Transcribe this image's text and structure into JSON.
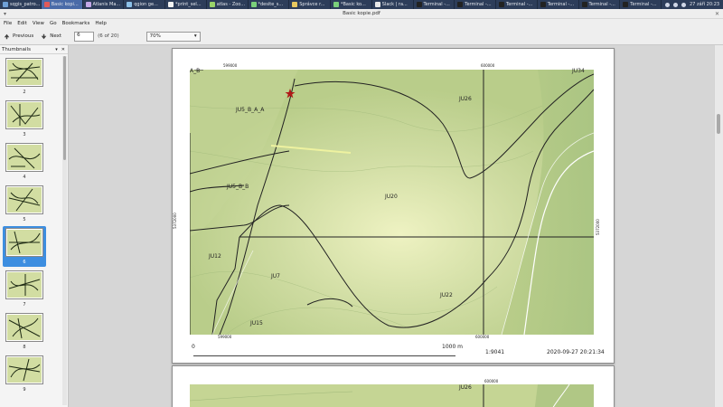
{
  "taskbar": {
    "apps": [
      {
        "label": "sqgis_patro..."
      },
      {
        "label": "Basic kopi..."
      },
      {
        "label": "Atlanis Ma..."
      },
      {
        "label": "qgion ge..."
      },
      {
        "label": "*print_sel..."
      },
      {
        "label": "atlas - Zoo..."
      },
      {
        "label": "*desite_s..."
      },
      {
        "label": "Správce r..."
      },
      {
        "label": "*Basic ko..."
      },
      {
        "label": "Slack | ra..."
      },
      {
        "label": "Terminal -..."
      },
      {
        "label": "Terminal -..."
      },
      {
        "label": "Terminal -..."
      },
      {
        "label": "Terminal -..."
      },
      {
        "label": "Terminal -..."
      },
      {
        "label": "Terminal -..."
      }
    ],
    "clock": "27 září 20:23"
  },
  "window": {
    "title": "Basic kopie.pdf"
  },
  "menu": [
    "File",
    "Edit",
    "View",
    "Go",
    "Bookmarks",
    "Help"
  ],
  "toolbar": {
    "previous_label": "Previous",
    "next_label": "Next",
    "page_value": "6",
    "page_of": "(6 of 20)",
    "zoom_value": "70%"
  },
  "sidebar": {
    "title": "Thumbnails",
    "thumbs": [
      {
        "label": "2"
      },
      {
        "label": "3"
      },
      {
        "label": "4"
      },
      {
        "label": "5"
      },
      {
        "label": "6"
      },
      {
        "label": "7"
      },
      {
        "label": "8"
      },
      {
        "label": "9"
      }
    ],
    "selected_index": 4
  },
  "map": {
    "zones": [
      {
        "label": "A_B"
      },
      {
        "label": "JU34"
      },
      {
        "label": "JU26"
      },
      {
        "label": "JU5_B_A_A"
      },
      {
        "label": "JU5_B_B"
      },
      {
        "label": "JU20"
      },
      {
        "label": "JU12"
      },
      {
        "label": "JU7"
      },
      {
        "label": "JU22"
      },
      {
        "label": "JU15"
      }
    ],
    "coords": {
      "top_a": "599000",
      "top_b": "600000",
      "bottom_a": "599000",
      "bottom_b": "600000",
      "left_side": "5372000",
      "right_side": "5372000"
    },
    "scale_start": "0",
    "scale_end": "1000 m",
    "scale_ratio": "1:9041",
    "timestamp": "2020-09-27 20:21:34",
    "next_page_label": "JU26",
    "next_page_coord": "600000"
  },
  "colors": {
    "map_green": "#c8d89a",
    "selected": "#3d8ee0",
    "taskbar": "#2d3d5a"
  }
}
